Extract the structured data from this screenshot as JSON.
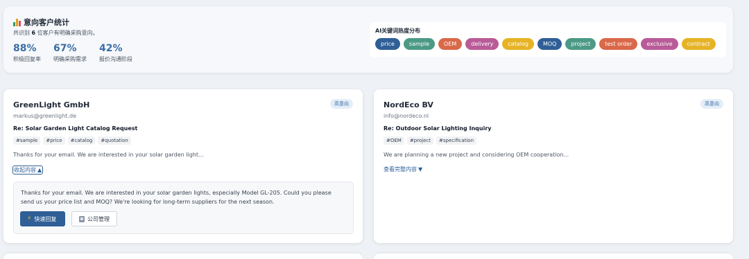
{
  "summary": {
    "title": "意向客户统计",
    "subtitle_prefix": "共识别",
    "count": "6",
    "subtitle_suffix": "位客户有明确采购意向。",
    "stats": [
      {
        "value": "88%",
        "label": "积极回复率"
      },
      {
        "value": "67%",
        "label": "明确采购需求"
      },
      {
        "value": "42%",
        "label": "报价沟通阶段"
      }
    ],
    "keywords_title": "AI关键词热度分布",
    "keywords": [
      {
        "label": "price",
        "color": "#2f5f96"
      },
      {
        "label": "sample",
        "color": "#4c9a86"
      },
      {
        "label": "OEM",
        "color": "#d9694a"
      },
      {
        "label": "delivery",
        "color": "#b95b98"
      },
      {
        "label": "catalog",
        "color": "#e6b325"
      },
      {
        "label": "MOQ",
        "color": "#2f5f96"
      },
      {
        "label": "project",
        "color": "#4c9a86"
      },
      {
        "label": "test order",
        "color": "#d9694a"
      },
      {
        "label": "exclusive",
        "color": "#b95b98"
      },
      {
        "label": "contract",
        "color": "#e6b325"
      }
    ]
  },
  "cards": [
    {
      "name": "GreenLight GmbH",
      "badge": "高意向",
      "email": "markus@greenlight.de",
      "subject": "Re: Solar Garden Light Catalog Request",
      "tags": [
        "#sample",
        "#price",
        "#catalog",
        "#quotation"
      ],
      "preview": "Thanks for your email. We are interested in your solar garden light...",
      "toggle": "收起内容",
      "toggle_arrow": "▲",
      "full_text": "Thanks for your email. We are interested in your solar garden lights, especially Model GL-205. Could you please send us your price list and MOQ? We're looking for long-term suppliers for the next season.",
      "quick_reply": "快速回复",
      "company_manage": "公司管理"
    },
    {
      "name": "NordEco BV",
      "badge": "高意向",
      "email": "info@nordeco.nl",
      "subject": "Re: Outdoor Solar Lighting Inquiry",
      "tags": [
        "#OEM",
        "#project",
        "#specification"
      ],
      "preview": "We are planning a new project and considering OEM cooperation...",
      "toggle": "查看完整内容",
      "toggle_arrow": "▼"
    }
  ],
  "icons": {
    "chart_colors": [
      "#2f9e5b",
      "#e0a126",
      "#d9534f"
    ],
    "bolt": "⚡"
  }
}
